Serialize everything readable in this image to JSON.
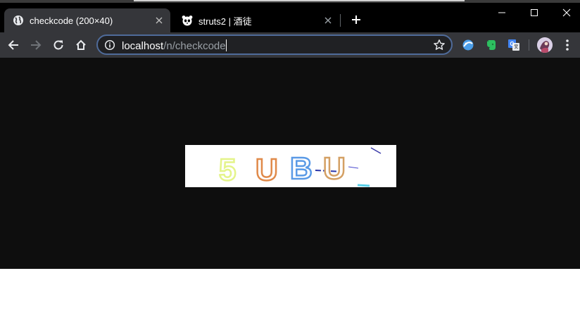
{
  "tabs": [
    {
      "title": "checkcode (200×40)",
      "icon": "globe-icon",
      "active": true
    },
    {
      "title": "struts2 | 酒徒",
      "icon": "panda-icon",
      "active": false
    }
  ],
  "address_bar": {
    "host": "localhost",
    "path": "/n/checkcode"
  },
  "extensions": [
    "blue-sphere-icon",
    "evernote-icon",
    "google-translate-icon"
  ],
  "captcha": {
    "characters": [
      "5",
      "U",
      "B",
      "U"
    ],
    "colors": [
      "#e4f48a",
      "#e08a4a",
      "#5a9ae6",
      "#d4a064"
    ]
  },
  "colors": {
    "tab_bar": "#000000",
    "toolbar": "#35363a",
    "omnibox_border": "#4f6b9a",
    "page_background": "#0e0e0e"
  }
}
